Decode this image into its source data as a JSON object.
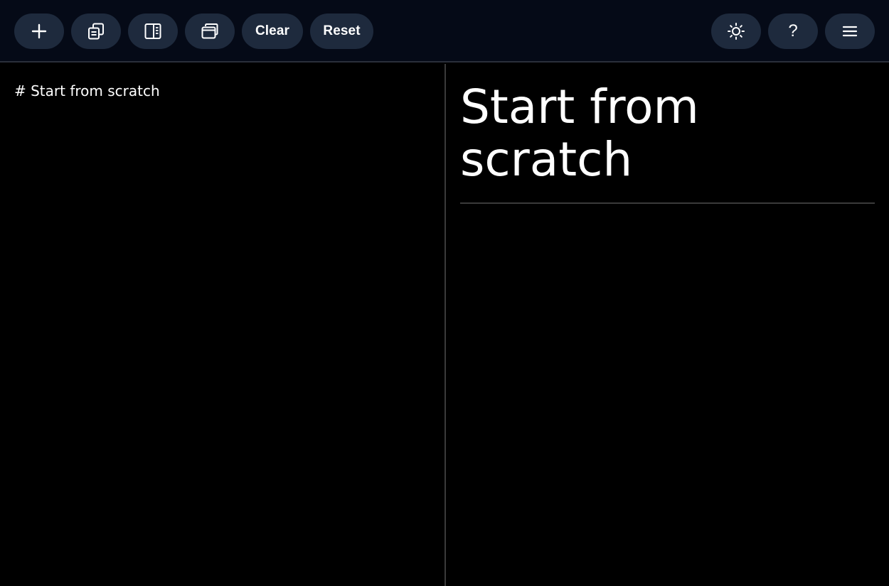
{
  "toolbar": {
    "left_buttons": [
      {
        "icon": "plus-icon"
      },
      {
        "icon": "copy-document-icon"
      },
      {
        "icon": "split-panel-icon"
      },
      {
        "icon": "windows-icon"
      }
    ],
    "clear_label": "Clear",
    "reset_label": "Reset",
    "right_buttons": [
      {
        "icon": "sun-icon"
      },
      {
        "icon": "help-icon",
        "glyph": "?"
      },
      {
        "icon": "hamburger-menu-icon"
      }
    ]
  },
  "editor": {
    "content": "# Start from scratch"
  },
  "preview": {
    "heading": "Start from scratch"
  },
  "colors": {
    "toolbar_bg": "#050a17",
    "button_bg": "#1e2a3d",
    "page_bg": "#000000",
    "text": "#ffffff",
    "divider": "#3a3a3a"
  }
}
